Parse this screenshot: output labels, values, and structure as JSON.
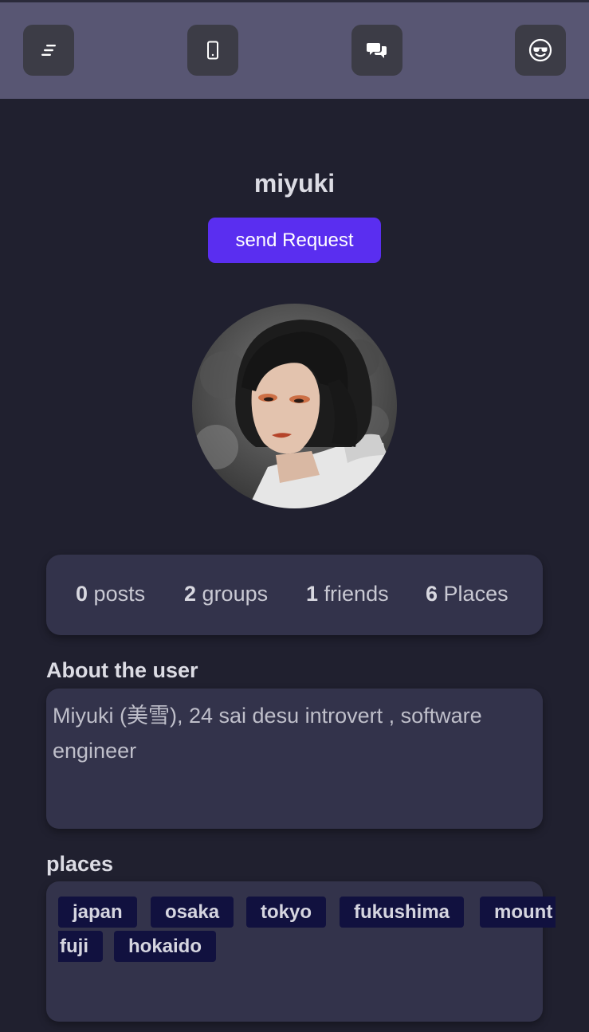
{
  "nav": {
    "items": [
      {
        "icon": "menu-icon",
        "name": "menu"
      },
      {
        "icon": "phone-icon",
        "name": "phone"
      },
      {
        "icon": "chat-bubbles-icon",
        "name": "chat"
      },
      {
        "icon": "smile-sunglasses-icon",
        "name": "profile"
      }
    ]
  },
  "profile": {
    "username": "miyuki",
    "send_request_label": "send Request",
    "avatar_icon": "user-avatar-photo"
  },
  "stats": {
    "posts_count": "0",
    "posts_label": "posts",
    "groups_count": "2",
    "groups_label": "groups",
    "friends_count": "1",
    "friends_label": "friends",
    "places_count": "6",
    "places_label": "Places"
  },
  "about": {
    "heading": "About the user",
    "text": "Miyuki (美雪), 24 sai desu introvert , software engineer"
  },
  "places": {
    "heading": "places",
    "tags": [
      "japan",
      "osaka",
      "tokyo",
      "fukushima",
      "mount",
      "fuji",
      "hokaido"
    ]
  },
  "colors": {
    "background": "#20202f",
    "topbar": "#585673",
    "accent": "#5a2ef0",
    "card": "#33334b",
    "chip": "#11113f"
  }
}
